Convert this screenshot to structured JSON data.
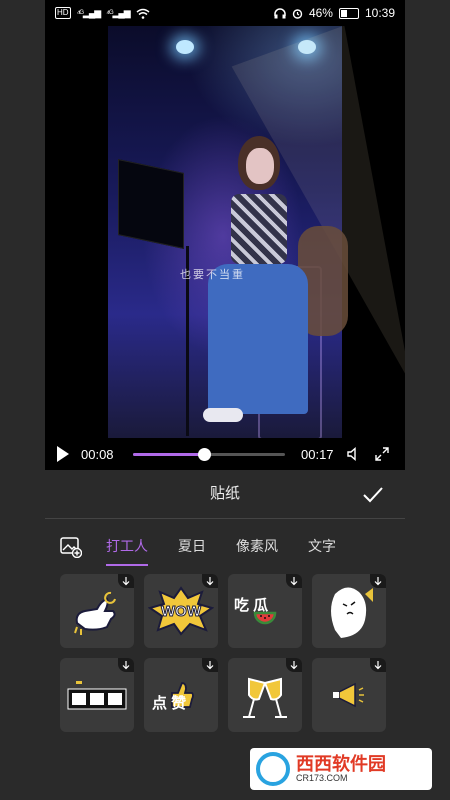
{
  "status_bar": {
    "left_icons": [
      "HD",
      "4G",
      "4G",
      "wifi"
    ],
    "battery": "46%",
    "battery_level": 0.46,
    "time": "10:39"
  },
  "video": {
    "subtitle": "也要不当重",
    "current_time": "00:08",
    "end_time": "00:17",
    "progress": 0.47
  },
  "panel": {
    "title": "贴纸"
  },
  "tabs": [
    {
      "label": "打工人",
      "active": true
    },
    {
      "label": "夏日",
      "active": false
    },
    {
      "label": "像素风",
      "active": false
    },
    {
      "label": "文字",
      "active": false
    }
  ],
  "stickers": [
    {
      "text": "",
      "icon": "call-me-hand-icon"
    },
    {
      "text": "WOW",
      "icon": "wow-burst-icon"
    },
    {
      "text": "吃 瓜",
      "icon": "watermelon-icon"
    },
    {
      "text": "",
      "icon": "ghost-icon"
    },
    {
      "text": "",
      "icon": "progress-blocks-icon"
    },
    {
      "text": "点 赞",
      "icon": "thumbs-up-icon"
    },
    {
      "text": "",
      "icon": "cheers-icon"
    },
    {
      "text": "",
      "icon": "megaphone-icon"
    }
  ],
  "watermark": {
    "text": "西西软件园",
    "url": "CR173.COM"
  },
  "colors": {
    "accent": "#b06ae8",
    "background": "#2a2a2a"
  }
}
